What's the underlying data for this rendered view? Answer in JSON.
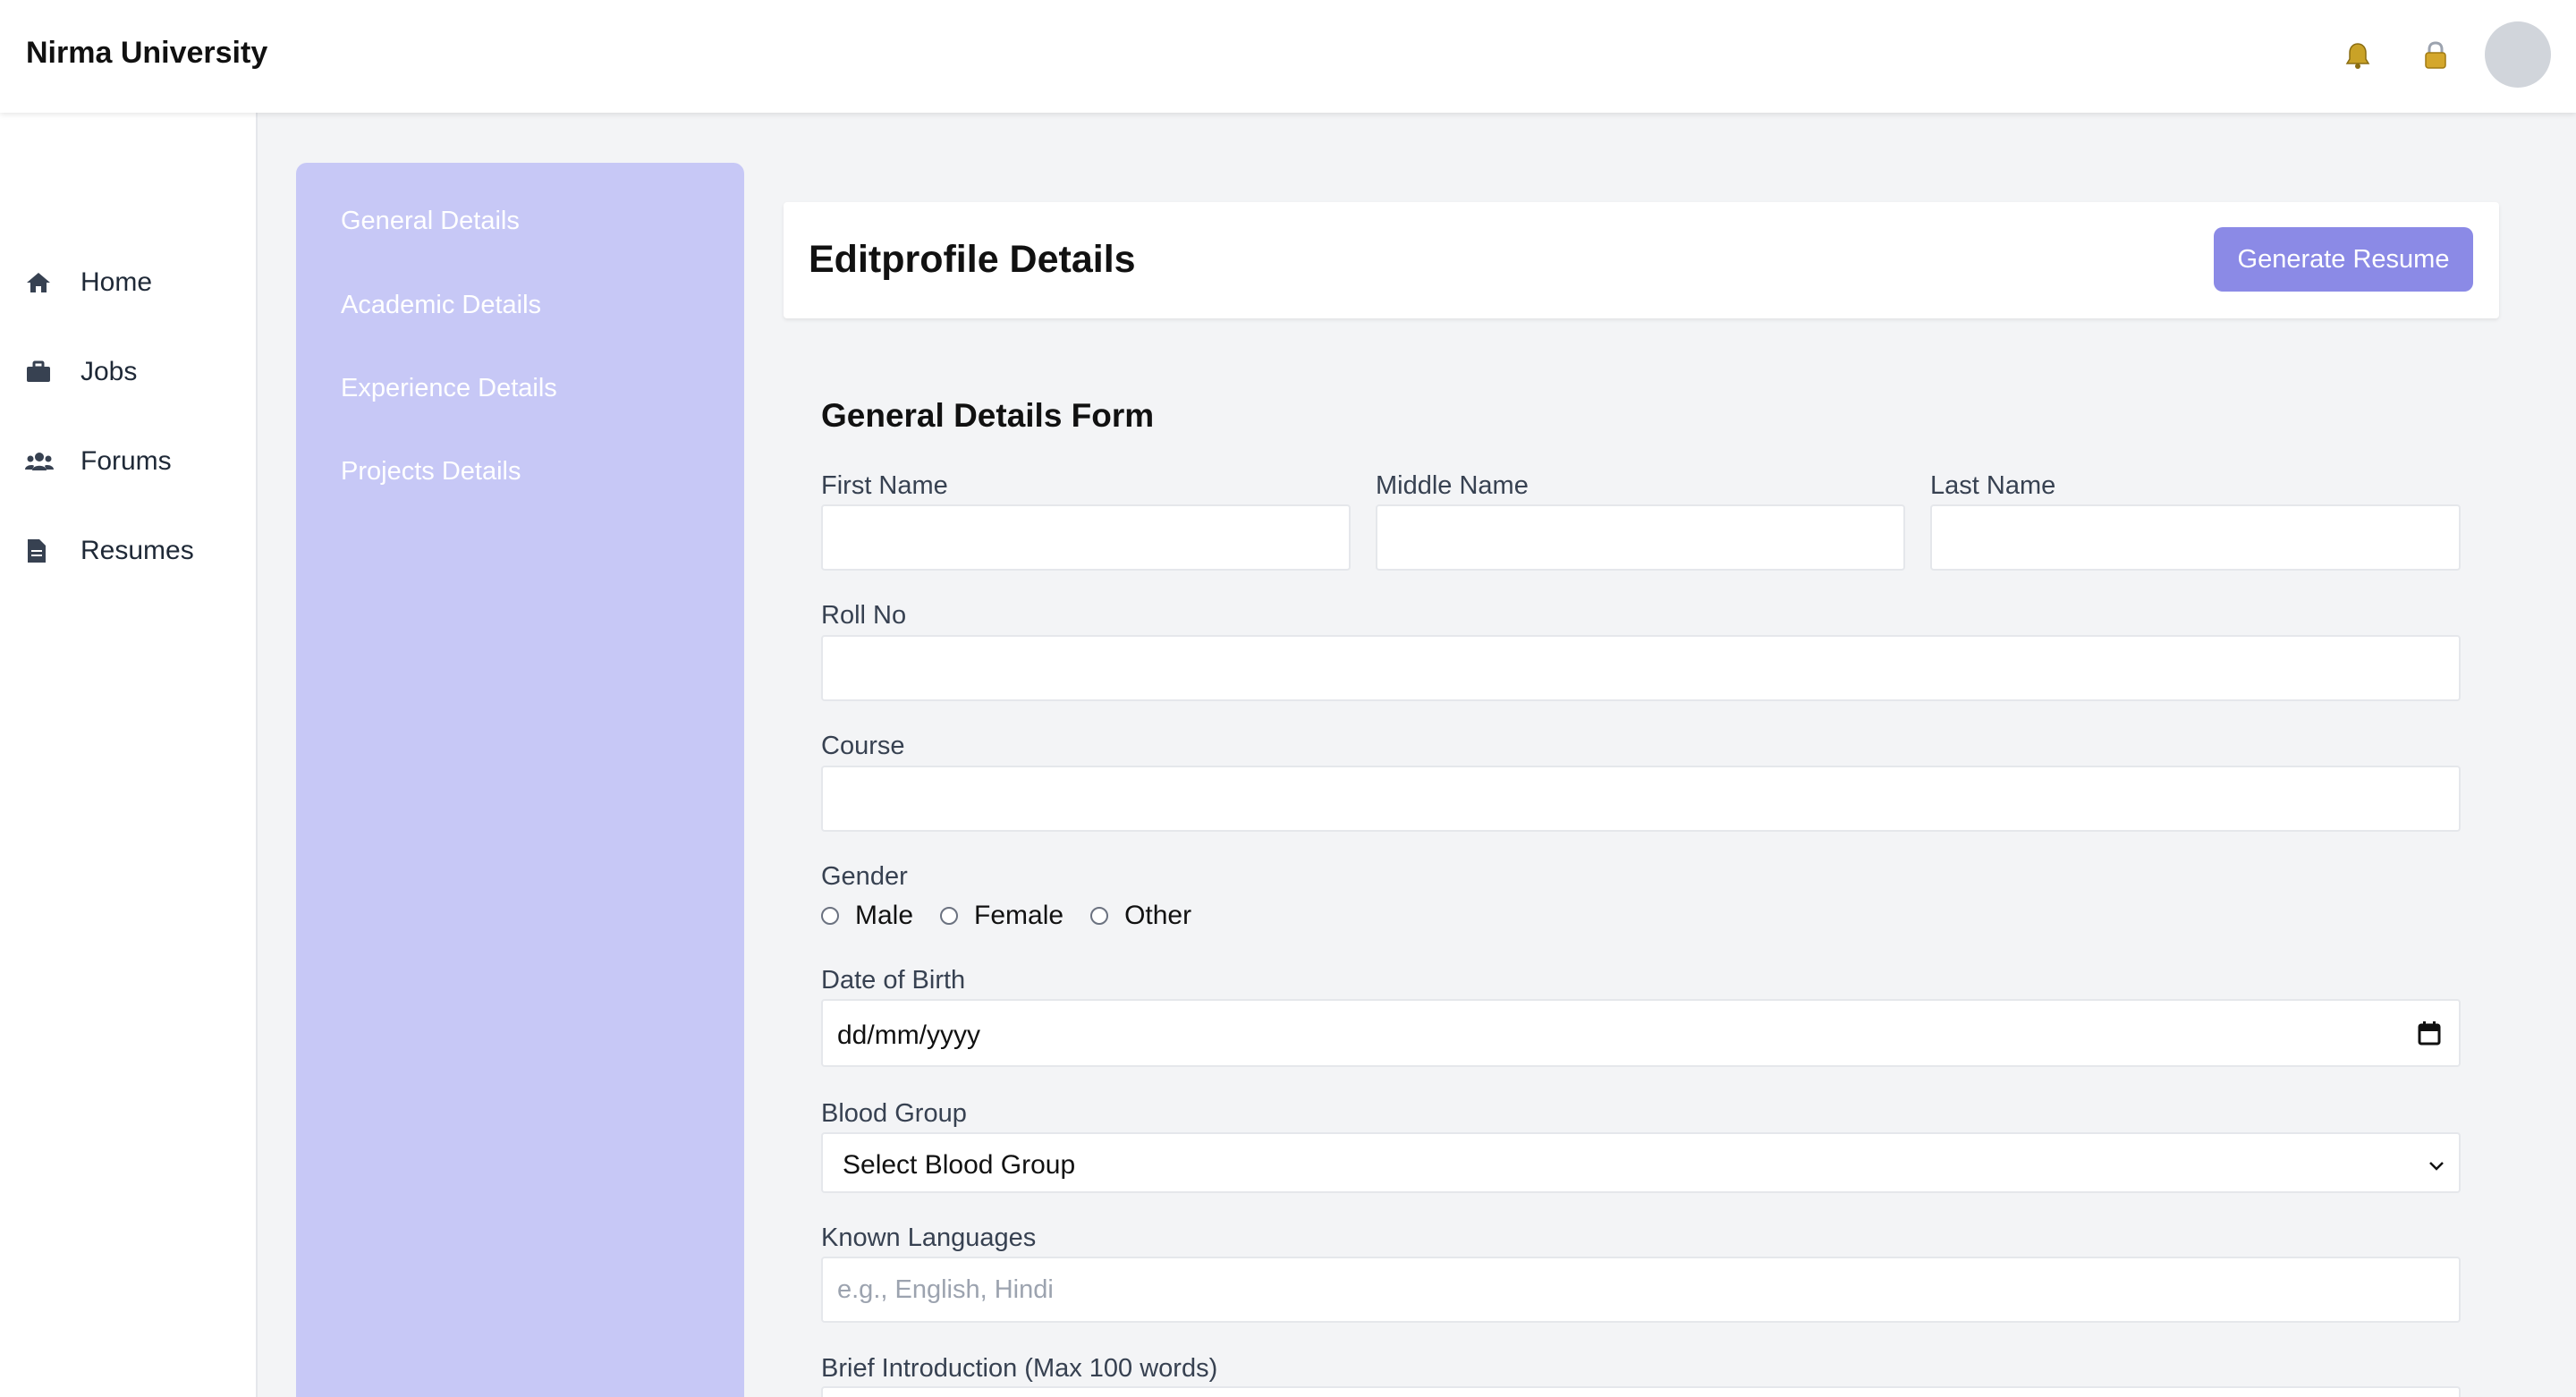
{
  "header": {
    "brand": "Nirma University",
    "icons": [
      "bell-icon",
      "lock-icon"
    ]
  },
  "sidebar": {
    "items": [
      {
        "label": "Home",
        "icon": "home-icon"
      },
      {
        "label": "Jobs",
        "icon": "briefcase-icon"
      },
      {
        "label": "Forums",
        "icon": "users-icon"
      },
      {
        "label": "Resumes",
        "icon": "document-icon"
      }
    ]
  },
  "subnav": {
    "items": [
      {
        "label": "General Details"
      },
      {
        "label": "Academic Details"
      },
      {
        "label": "Experience Details"
      },
      {
        "label": "Projects Details"
      }
    ]
  },
  "page": {
    "title": "Editprofile Details",
    "generate_button": "Generate Resume"
  },
  "form": {
    "title": "General Details Form",
    "first_name": {
      "label": "First Name",
      "value": ""
    },
    "middle_name": {
      "label": "Middle Name",
      "value": ""
    },
    "last_name": {
      "label": "Last Name",
      "value": ""
    },
    "roll_no": {
      "label": "Roll No",
      "value": ""
    },
    "course": {
      "label": "Course",
      "value": ""
    },
    "gender": {
      "label": "Gender",
      "options": [
        "Male",
        "Female",
        "Other"
      ]
    },
    "dob": {
      "label": "Date of Birth",
      "placeholder": "dd/mm/yyyy"
    },
    "blood_group": {
      "label": "Blood Group",
      "selected": "Select Blood Group"
    },
    "languages": {
      "label": "Known Languages",
      "placeholder": "e.g., English, Hindi"
    },
    "intro": {
      "label": "Brief Introduction (Max 100 words)"
    }
  },
  "colors": {
    "accent": "#8b8ae6",
    "subnav_bg": "#c7c8f6",
    "page_bg": "#f3f4f6"
  }
}
